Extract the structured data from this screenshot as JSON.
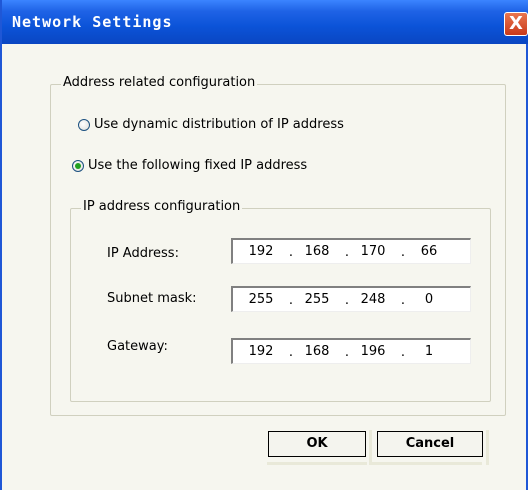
{
  "window": {
    "title": "Network Settings",
    "close_label": "X"
  },
  "address_group": {
    "legend": "Address related configuration",
    "options": [
      {
        "label": "Use dynamic distribution of IP address",
        "checked": false
      },
      {
        "label": "Use the following fixed IP address",
        "checked": true
      }
    ]
  },
  "ip_group": {
    "legend": "IP address configuration",
    "fields": [
      {
        "label": "IP Address:",
        "octets": [
          "192",
          "168",
          "170",
          "66"
        ]
      },
      {
        "label": "Subnet mask:",
        "octets": [
          "255",
          "255",
          "248",
          "0"
        ]
      },
      {
        "label": "Gateway:",
        "octets": [
          "192",
          "168",
          "196",
          "1"
        ]
      }
    ],
    "separator": "."
  },
  "buttons": {
    "ok": "OK",
    "cancel": "Cancel"
  }
}
